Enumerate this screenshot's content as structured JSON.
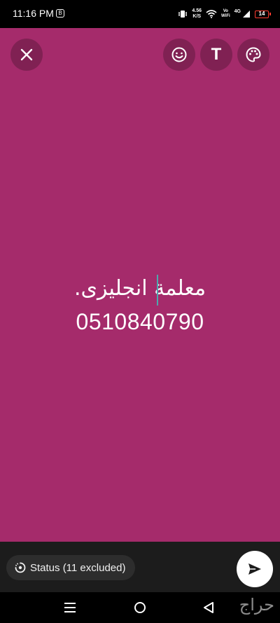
{
  "status_bar": {
    "time": "11:16 PM",
    "app_badge": "B",
    "speed_value": "4.56",
    "speed_unit": "K/S",
    "volte_top": "Vo",
    "volte_bottom": "WiFi",
    "network": "4G",
    "battery": "14"
  },
  "toolbar": {
    "close_icon": "close-icon",
    "emoji_icon": "emoji-icon",
    "text_label": "T",
    "palette_icon": "palette-icon"
  },
  "status_text": {
    "line1": "معلمة انجليزى.",
    "line2": "0510840790"
  },
  "composer": {
    "audience_label": "Status (11 excluded)",
    "send_icon": "send-icon"
  },
  "watermark": "حراج",
  "colors": {
    "background": "#a52b6b",
    "cursor": "#4ea7ad",
    "bottom_bar": "#1c1c1c"
  }
}
